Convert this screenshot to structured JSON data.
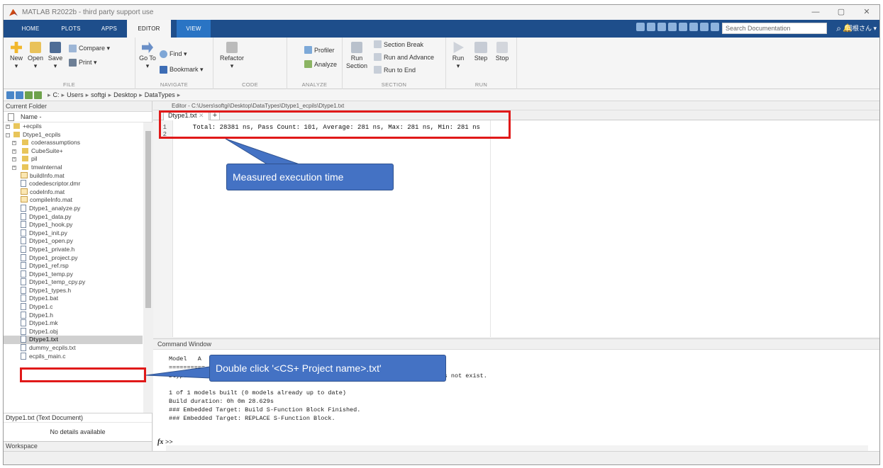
{
  "window": {
    "title": "MATLAB R2022b - third party support use",
    "min": "—",
    "max": "▢",
    "close": "✕"
  },
  "tabs": [
    {
      "label": "HOME"
    },
    {
      "label": "PLOTS"
    },
    {
      "label": "APPS"
    },
    {
      "label": "EDITOR"
    },
    {
      "label": "VIEW"
    }
  ],
  "search_placeholder": "Search Documentation",
  "user_label": "岡根さん ▾",
  "ribbon": {
    "file": {
      "new": "New",
      "open": "Open",
      "save": "Save",
      "compare": "Compare ▾",
      "print": "Print ▾",
      "footer": "FILE"
    },
    "navigate": {
      "goto": "Go To",
      "find": "Find ▾",
      "bookmark": "Bookmark ▾",
      "footer": "NAVIGATE"
    },
    "code": {
      "refactor": "Refactor",
      "footer": "CODE"
    },
    "analyze": {
      "profiler": "Profiler",
      "analyze": "Analyze",
      "footer": "ANALYZE"
    },
    "section": {
      "run_section": "Run Section",
      "section_break": "Section Break",
      "run_advance": "Run and Advance",
      "run_end": "Run to End",
      "footer": "SECTION"
    },
    "run": {
      "run": "Run",
      "step": "Step",
      "stop": "Stop",
      "footer": "RUN"
    }
  },
  "address": {
    "crumbs": [
      "C:",
      "Users",
      "softgi",
      "Desktop",
      "DataTypes"
    ]
  },
  "current_folder": {
    "title": "Current Folder",
    "col_name": "Name -",
    "items": [
      {
        "label": "+ecpils",
        "kind": "folder",
        "level": 0,
        "expand": "⊞"
      },
      {
        "label": "Dtype1_ecpils",
        "kind": "folder",
        "level": 0,
        "expand": "⊟"
      },
      {
        "label": "coderassumptions",
        "kind": "folder",
        "level": 1,
        "expand": "⊞"
      },
      {
        "label": "CubeSuite+",
        "kind": "folder",
        "level": 1,
        "expand": "⊞"
      },
      {
        "label": "pil",
        "kind": "folder",
        "level": 1,
        "expand": "⊞"
      },
      {
        "label": "tmwinternal",
        "kind": "folder",
        "level": 1,
        "expand": "⊞"
      },
      {
        "label": "buildInfo.mat",
        "kind": "mat",
        "level": 1
      },
      {
        "label": "codedescriptor.dmr",
        "kind": "file",
        "level": 1
      },
      {
        "label": "codeInfo.mat",
        "kind": "mat",
        "level": 1
      },
      {
        "label": "compileInfo.mat",
        "kind": "mat",
        "level": 1
      },
      {
        "label": "Dtype1_analyze.py",
        "kind": "file",
        "level": 1
      },
      {
        "label": "Dtype1_data.py",
        "kind": "file",
        "level": 1
      },
      {
        "label": "Dtype1_hook.py",
        "kind": "file",
        "level": 1
      },
      {
        "label": "Dtype1_init.py",
        "kind": "file",
        "level": 1
      },
      {
        "label": "Dtype1_open.py",
        "kind": "file",
        "level": 1
      },
      {
        "label": "Dtype1_private.h",
        "kind": "file",
        "level": 1
      },
      {
        "label": "Dtype1_project.py",
        "kind": "file",
        "level": 1
      },
      {
        "label": "Dtype1_ref.rsp",
        "kind": "file",
        "level": 1
      },
      {
        "label": "Dtype1_temp.py",
        "kind": "file",
        "level": 1
      },
      {
        "label": "Dtype1_temp_cpy.py",
        "kind": "file",
        "level": 1
      },
      {
        "label": "Dtype1_types.h",
        "kind": "file",
        "level": 1
      },
      {
        "label": "Dtype1.bat",
        "kind": "file",
        "level": 1
      },
      {
        "label": "Dtype1.c",
        "kind": "file",
        "level": 1
      },
      {
        "label": "Dtype1.h",
        "kind": "file",
        "level": 1
      },
      {
        "label": "Dtype1.mk",
        "kind": "file",
        "level": 1
      },
      {
        "label": "Dtype1.obj",
        "kind": "file",
        "level": 1
      },
      {
        "label": "Dtype1.txt",
        "kind": "file",
        "level": 1,
        "selected": true
      },
      {
        "label": "dummy_ecpils.txt",
        "kind": "file",
        "level": 1
      },
      {
        "label": "ecpils_main.c",
        "kind": "file",
        "level": 1
      }
    ],
    "details_title": "Dtype1.txt (Text Document)",
    "details_text": "No details available",
    "workspace": "Workspace"
  },
  "editor": {
    "path": "Editor - C:\\Users\\softgi\\Desktop\\DataTypes\\Dtype1_ecpils\\Dtype1.txt",
    "tab": "Dtype1.txt",
    "line_numbers": [
      "1",
      "2"
    ],
    "line1": "  Total: 28381 ns, Pass Count: 101, Average: 281 ns, Max: 281 ns, Min: 281 ns"
  },
  "command_window": {
    "title": "Command Window",
    "lines": [
      "Model   A",
      "==========",
      "Dtyper  C                                                        on file does not exist.",
      "",
      "1 of 1 models built (0 models already up to date)",
      "Build duration: 0h 0m 28.629s",
      "### Embedded Target: Build S-Function Block Finished.",
      "### Embedded Target: REPLACE S-Function Block."
    ],
    "prompt": ">>"
  },
  "annotations": {
    "exec_time": "Measured execution time",
    "double_click": "Double click '<CS+ Project name>.txt'",
    "color": "#4472c4",
    "box_color": "#e01919"
  }
}
